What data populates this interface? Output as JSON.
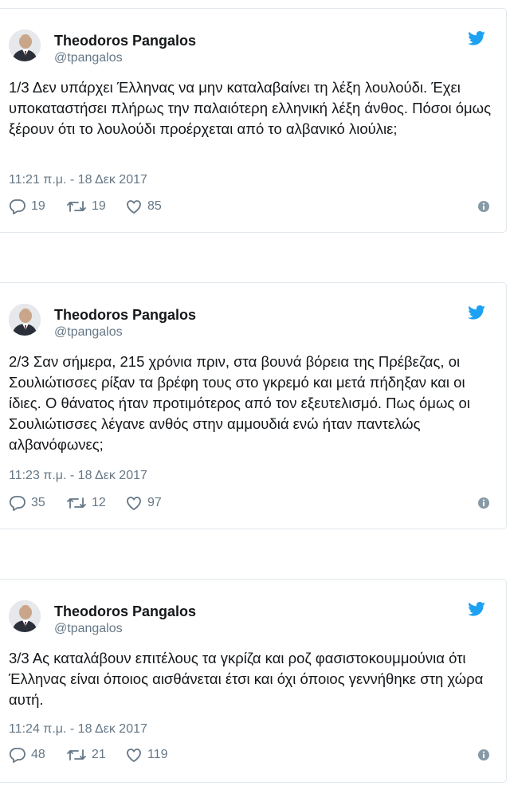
{
  "tweets": [
    {
      "author": "Theodoros Pangalos",
      "handle": "@tpangalos",
      "text": "1/3 Δεν υπάρχει Έλληνας να μην καταλαβαίνει τη λέξη λουλούδι. Έχει υποκαταστήσει πλήρως την παλαιότερη ελληνική λέξη άνθος. Πόσοι όμως ξέρουν ότι το λουλούδι προέρχεται από το αλβανικό λιούλιε;",
      "timestamp": "11:21 π.μ. - 18 Δεκ 2017",
      "replies": "19",
      "retweets": "19",
      "likes": "85"
    },
    {
      "author": "Theodoros Pangalos",
      "handle": "@tpangalos",
      "text": "2/3 Σαν σήμερα, 215 χρόνια πριν, στα βουνά βόρεια της Πρέβεζας, οι Σουλιώτισσες ρίξαν τα βρέφη τους στο γκρεμό και μετά πήδηξαν και οι ίδιες. Ο θάνατος ήταν προτιμότερος από τον εξευτελισμό. Πως όμως οι Σουλιώτισσες λέγανε ανθός στην αμμουδιά ενώ ήταν παντελώς αλβανόφωνες;",
      "timestamp": "11:23 π.μ. - 18 Δεκ 2017",
      "replies": "35",
      "retweets": "12",
      "likes": "97"
    },
    {
      "author": "Theodoros Pangalos",
      "handle": "@tpangalos",
      "text": "3/3 Ας καταλάβουν επιτέλους τα γκρίζα και ροζ φασιστοκουμμούνια ότι Έλληνας είναι όποιος αισθάνεται έτσι και όχι όποιος γεννήθηκε στη χώρα αυτή.",
      "timestamp": "11:24 π.μ. - 18 Δεκ 2017",
      "replies": "48",
      "retweets": "21",
      "likes": "119"
    }
  ],
  "icons": {
    "reply": "reply-icon",
    "retweet": "retweet-icon",
    "like": "heart-icon",
    "info": "info-icon",
    "brand": "twitter-bird-icon"
  },
  "colors": {
    "twitter_blue": "#1da1f2",
    "secondary_text": "#657786",
    "border": "#e1e8ed"
  }
}
